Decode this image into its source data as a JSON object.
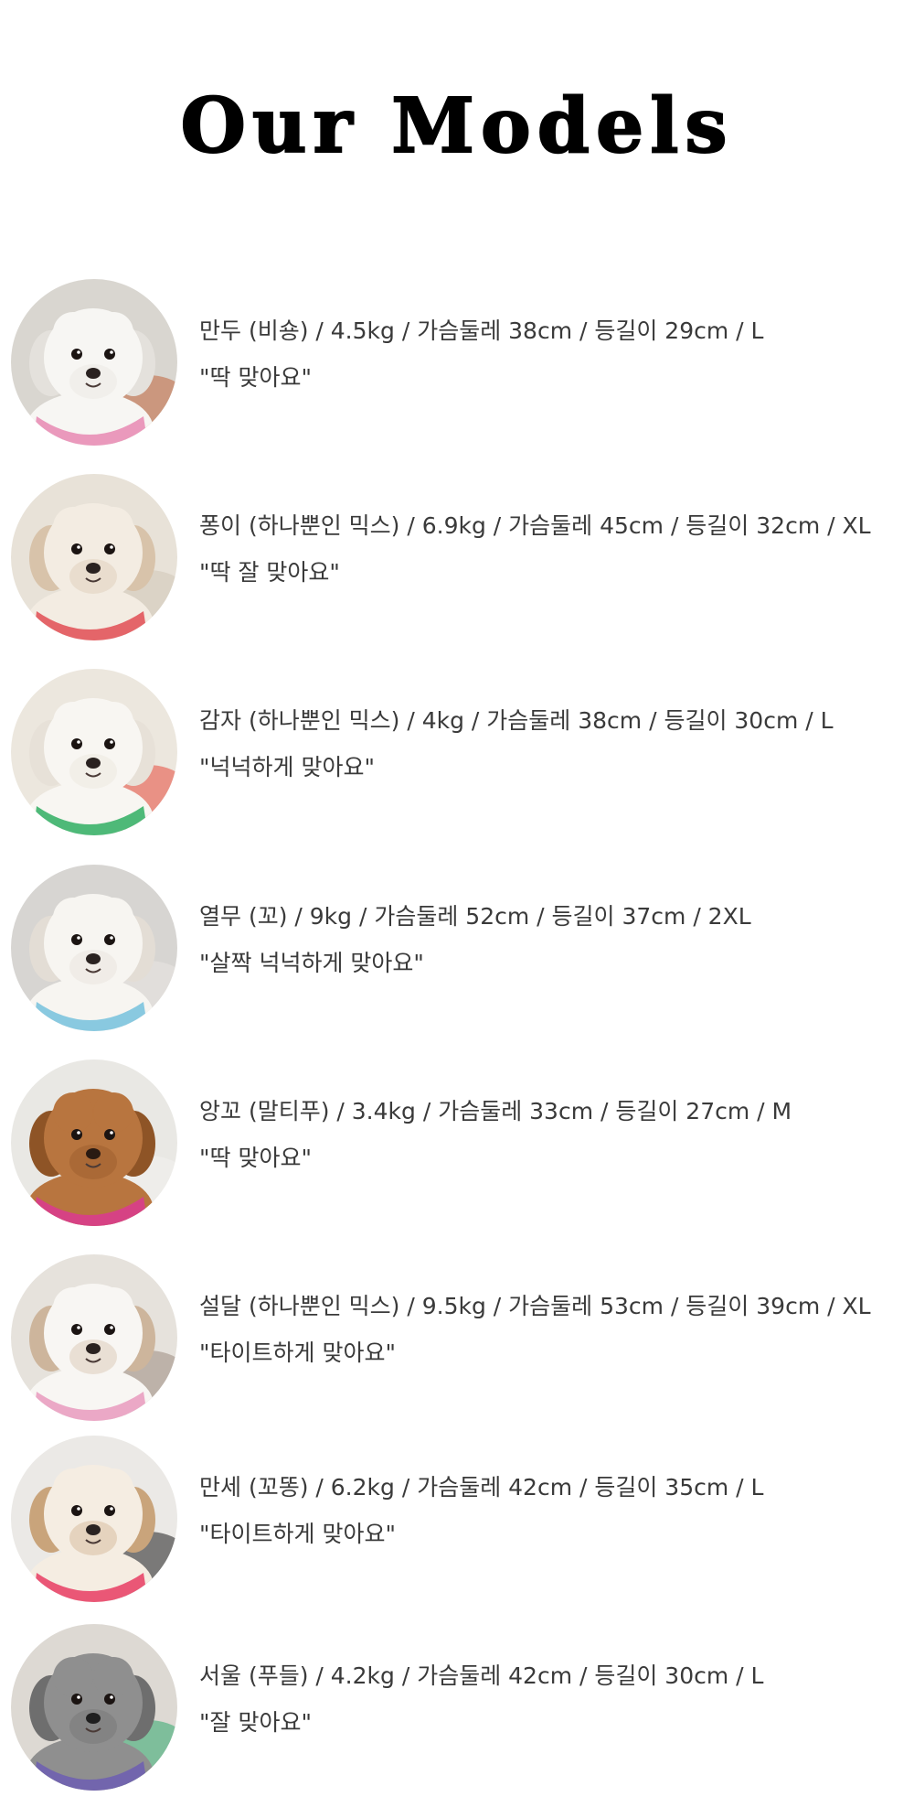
{
  "page": {
    "title": "Our Models"
  },
  "models": [
    {
      "spec": "만두 (비숑) / 4.5kg / 가슴둘레 38cm / 등길이 29cm / L",
      "comment": "\"딱 맞아요\"",
      "photo": {
        "bg": "#d9d6d0",
        "fur": "#f7f6f3",
        "shade": "#e4e1dc",
        "accent": "#e88fb6",
        "accent2": "#c0643b",
        "nose": "#2a2220"
      }
    },
    {
      "spec": "퐁이 (하나뿐인 믹스) / 6.9kg / 가슴둘레 45cm / 등길이 32cm / XL",
      "comment": "\"딱 잘 맞아요\"",
      "photo": {
        "bg": "#e8e2d8",
        "fur": "#f3ece2",
        "shade": "#d8c3aa",
        "accent": "#e2565c",
        "accent2": "#cfc6b8",
        "nose": "#2a2220"
      }
    },
    {
      "spec": "감자 (하나뿐인 믹스) / 4kg / 가슴둘레 38cm / 등길이 30cm / L",
      "comment": "\"넉넉하게 맞아요\"",
      "photo": {
        "bg": "#ece7de",
        "fur": "#f8f6f2",
        "shade": "#e7e1d8",
        "accent": "#3bb36a",
        "accent2": "#e84a3c",
        "nose": "#2a2220"
      }
    },
    {
      "spec": "열무 (꼬) / 9kg / 가슴둘레 52cm / 등길이 37cm / 2XL",
      "comment": "\"살짝 넉넉하게 맞아요\"",
      "photo": {
        "bg": "#d7d5d2",
        "fur": "#f7f5f1",
        "shade": "#e3ddd5",
        "accent": "#7cc4de",
        "accent2": "#e9e6e1",
        "nose": "#2a2220"
      }
    },
    {
      "spec": "앙꼬 (말티푸) / 3.4kg / 가슴둘레 33cm / 등길이 27cm / M",
      "comment": "\"딱 맞아요\"",
      "photo": {
        "bg": "#e9e8e4",
        "fur": "#b8753f",
        "shade": "#8e5426",
        "accent": "#d93d8c",
        "accent2": "#f2f1ee",
        "nose": "#2a1a12"
      }
    },
    {
      "spec": "설달 (하나뿐인 믹스) / 9.5kg / 가슴둘레 53cm / 등길이 39cm / XL",
      "comment": "\"타이트하게 맞아요\"",
      "photo": {
        "bg": "#e6e2dc",
        "fur": "#f8f6f3",
        "shade": "#cdb59c",
        "accent": "#e9a0c1",
        "accent2": "#9a8b80",
        "nose": "#2a2220"
      }
    },
    {
      "spec": "만세 (꼬똥) / 6.2kg / 가슴둘레 42cm / 등길이 35cm / L",
      "comment": "\"타이트하게 맞아요\"",
      "photo": {
        "bg": "#ebe9e6",
        "fur": "#f5ede2",
        "shade": "#c9a47b",
        "accent": "#e9466a",
        "accent2": "#1e1e1e",
        "nose": "#2a2220"
      }
    },
    {
      "spec": "서울 (푸들) / 4.2kg / 가슴둘레 42cm / 등길이 30cm / L",
      "comment": "\"잘 맞아요\"",
      "photo": {
        "bg": "#ddd9d3",
        "fur": "#8f8f8f",
        "shade": "#6e6e6e",
        "accent": "#6f61b0",
        "accent2": "#2fa86d",
        "nose": "#1f1f1f"
      }
    }
  ]
}
